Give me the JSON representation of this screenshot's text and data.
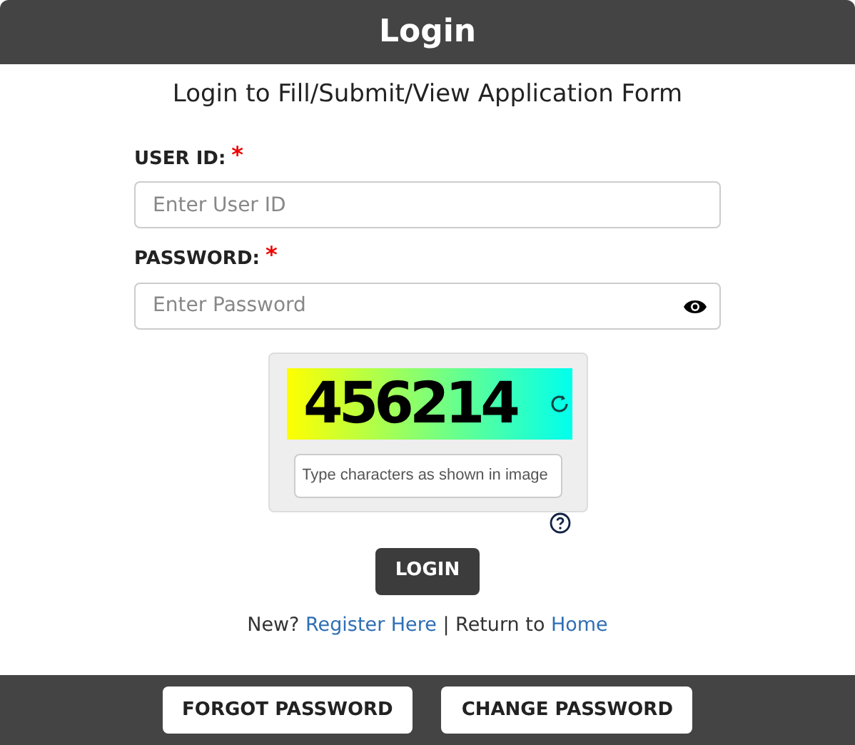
{
  "header": {
    "title": "Login"
  },
  "subtitle": "Login to Fill/Submit/View Application Form",
  "fields": [
    {
      "kind": "text",
      "label": "USER ID:",
      "required_mark": "*",
      "placeholder": "Enter User ID"
    },
    {
      "kind": "password",
      "label": "PASSWORD:",
      "required_mark": "*",
      "placeholder": "Enter Password"
    }
  ],
  "captcha": {
    "code": "456214",
    "placeholder": "Type characters as shown in image"
  },
  "login_button": "LOGIN",
  "footer_line": {
    "prefix": "New?",
    "register_link": "Register Here",
    "middle": "| Return to",
    "home_link": "Home"
  },
  "bottom_buttons": [
    "FORGOT PASSWORD",
    "CHANGE PASSWORD"
  ]
}
